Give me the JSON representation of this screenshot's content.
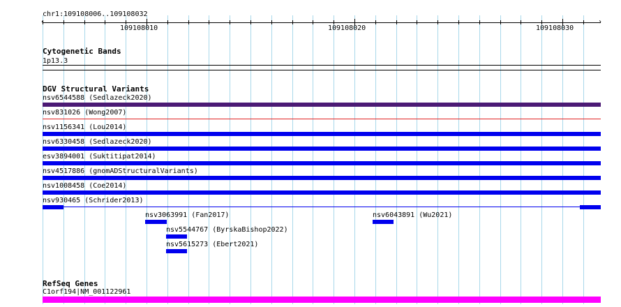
{
  "ruler": {
    "location": "chr1:109108006..109108032",
    "start": 109108006,
    "end": 109108032,
    "labeled_ticks": [
      "109108010",
      "109108020",
      "109108030"
    ]
  },
  "tracks": {
    "cytoband": {
      "title": "Cytogenetic Bands",
      "band": "1p13.3"
    },
    "dgv": {
      "title": "DGV Structural Variants",
      "features": [
        {
          "label": "nsv6544588 (Sedlazeck2020)",
          "color": "#4b1a75",
          "style": "full"
        },
        {
          "label": "nsv831026 (Wong2007)",
          "color": "#e02020",
          "style": "thin"
        },
        {
          "label": "nsv1156341 (Lou2014)",
          "color": "#0000ee",
          "style": "full"
        },
        {
          "label": "nsv6330458 (Sedlazeck2020)",
          "color": "#0000ee",
          "style": "full"
        },
        {
          "label": "esv3894001 (Suktitipat2014)",
          "color": "#0000ee",
          "style": "full"
        },
        {
          "label": "nsv4517886 (gnomADStructuralVariants)",
          "color": "#0000ee",
          "style": "full"
        },
        {
          "label": "nsv1008458 (Coe2014)",
          "color": "#0000ee",
          "style": "full"
        },
        {
          "label": "nsv930465 (Schrider2013)",
          "color": "#0000ee",
          "style": "split"
        }
      ],
      "small_features": [
        {
          "label": "nsv3063991 (Fan2017)",
          "color": "#0000ee"
        },
        {
          "label": "nsv6043891 (Wu2021)",
          "color": "#0000ee"
        },
        {
          "label": "nsv5544767 (ByrskaBishop2022)",
          "color": "#0000ee"
        },
        {
          "label": "nsv5615273 (Ebert2021)",
          "color": "#0000ee"
        }
      ]
    },
    "refseq": {
      "title": "RefSeq Genes",
      "gene": "C1orf194|NM_001122961",
      "color": "#ff00ff"
    }
  }
}
